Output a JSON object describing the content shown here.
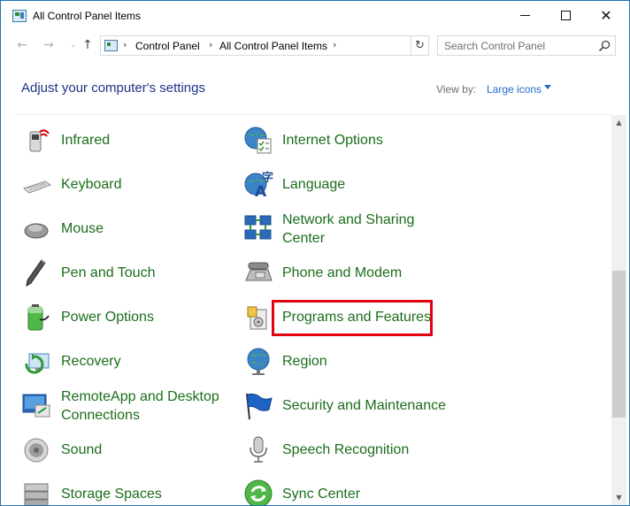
{
  "window": {
    "title": "All Control Panel Items",
    "controls": {
      "minimize": "",
      "maximize": "",
      "close": "✕"
    }
  },
  "nav": {
    "back": "←",
    "forward": "→",
    "recent": "⌄",
    "up": "↑",
    "breadcrumbs": [
      "Control Panel",
      "All Control Panel Items"
    ],
    "refresh": "↻",
    "search_placeholder": "Search Control Panel"
  },
  "header": {
    "title": "Adjust your computer's settings",
    "view_by_label": "View by:",
    "view_by_value": "Large icons"
  },
  "items_left": [
    {
      "label": "Infrared",
      "icon": "infrared-icon"
    },
    {
      "label": "Keyboard",
      "icon": "keyboard-icon"
    },
    {
      "label": "Mouse",
      "icon": "mouse-icon"
    },
    {
      "label": "Pen and Touch",
      "icon": "pen-icon"
    },
    {
      "label": "Power Options",
      "icon": "battery-icon"
    },
    {
      "label": "Recovery",
      "icon": "recovery-icon"
    },
    {
      "label": "RemoteApp and Desktop Connections",
      "icon": "remote-desktop-icon"
    },
    {
      "label": "Sound",
      "icon": "speaker-icon"
    },
    {
      "label": "Storage Spaces",
      "icon": "storage-icon"
    }
  ],
  "items_right": [
    {
      "label": "Internet Options",
      "icon": "globe-checklist-icon"
    },
    {
      "label": "Language",
      "icon": "language-icon"
    },
    {
      "label": "Network and Sharing Center",
      "icon": "network-icon"
    },
    {
      "label": "Phone and Modem",
      "icon": "phone-icon"
    },
    {
      "label": "Programs and Features",
      "icon": "programs-icon",
      "highlighted": true
    },
    {
      "label": "Region",
      "icon": "region-globe-icon"
    },
    {
      "label": "Security and Maintenance",
      "icon": "flag-icon"
    },
    {
      "label": "Speech Recognition",
      "icon": "microphone-icon"
    },
    {
      "label": "Sync Center",
      "icon": "sync-icon"
    }
  ],
  "colors": {
    "link_green": "#1b6d1b",
    "header_blue": "#1e3287",
    "accent_blue": "#1e6bc5",
    "highlight_red": "#e3000f"
  }
}
